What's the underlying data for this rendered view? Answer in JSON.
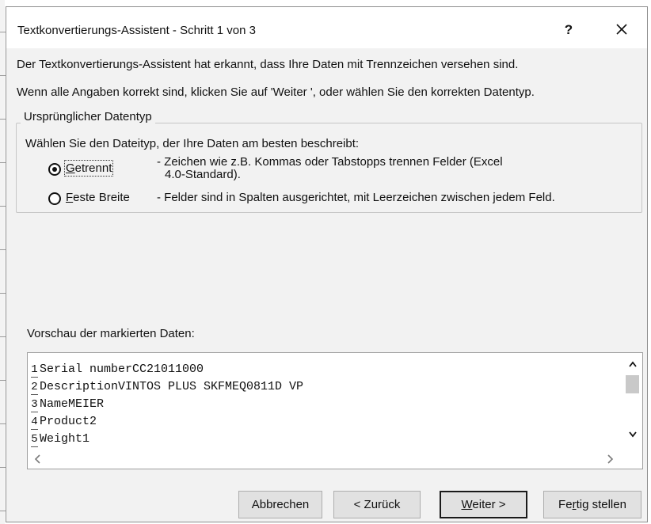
{
  "window": {
    "title": "Textkonvertierungs-Assistent - Schritt 1 von 3",
    "help_label": "?"
  },
  "description": {
    "line1": "Der Textkonvertierungs-Assistent hat erkannt, dass Ihre Daten mit Trennzeichen versehen sind.",
    "line2": "Wenn alle Angaben korrekt sind, klicken Sie auf 'Weiter ', oder wählen Sie den korrekten Datentyp."
  },
  "datatype_group": {
    "legend": "Ursprünglicher Datentyp",
    "prompt": "Wählen Sie den Dateityp, der Ihre Daten am besten beschreibt:",
    "options": [
      {
        "mnemonic": "G",
        "label_rest": "etrennt",
        "description_line1": "- Zeichen wie z.B. Kommas oder Tabstopps trennen Felder (Excel",
        "description_line2": "4.0-Standard).",
        "selected": true
      },
      {
        "mnemonic": "F",
        "label_rest": "este Breite",
        "description_line1": "- Felder sind in Spalten ausgerichtet, mit Leerzeichen zwischen jedem Feld.",
        "selected": false
      }
    ]
  },
  "preview": {
    "label": "Vorschau der markierten Daten:",
    "rows": [
      {
        "num": "1",
        "text": "Serial numberCC21011000"
      },
      {
        "num": "2",
        "text": "DescriptionVINTOS PLUS SKFMEQ0811D VP"
      },
      {
        "num": "3",
        "text": "NameMEIER"
      },
      {
        "num": "4",
        "text": "Product2"
      },
      {
        "num": "5",
        "text": "Weight1"
      }
    ],
    "scroll_up_icon": "^",
    "scroll_down_icon": "v",
    "scroll_left_icon": "<",
    "scroll_right_icon": ">"
  },
  "buttons": {
    "cancel": {
      "label": "Abbrechen"
    },
    "back": {
      "label": "< Zurück"
    },
    "next": {
      "mnemonic": "W",
      "label_rest": "eiter >"
    },
    "finish": {
      "label_pre": "Fe",
      "mnemonic": "r",
      "label_post": "tig stellen"
    }
  }
}
